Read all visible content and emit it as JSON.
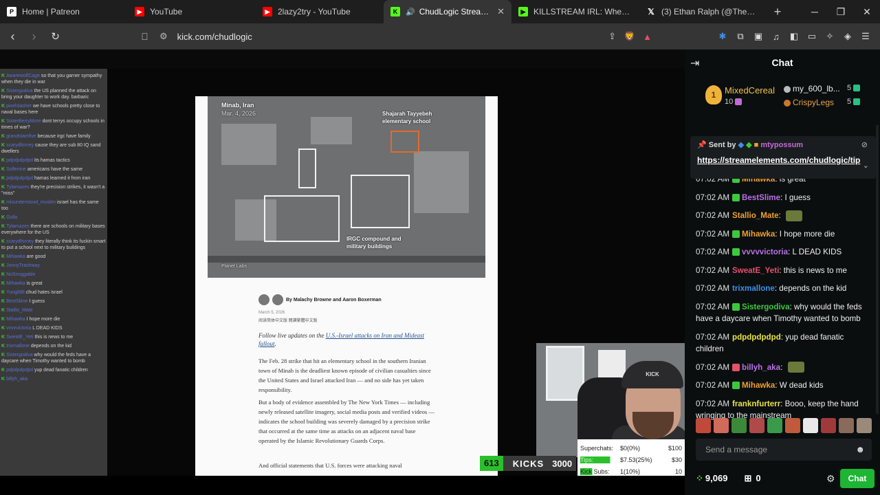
{
  "browser": {
    "tabs": [
      {
        "label": "Home | Patreon",
        "active": false
      },
      {
        "label": "YouTube",
        "active": false
      },
      {
        "label": "2lazy2try - YouTube",
        "active": false
      },
      {
        "label": "ChudLogic Stream - Wat",
        "active": true
      },
      {
        "label": "KILLSTREAM IRL: When Ethan M",
        "active": false
      },
      {
        "label": "(3) Ethan Ralph (@TheRalphRet",
        "active": false
      }
    ],
    "url": "kick.com/chudlogic"
  },
  "stream": {
    "overlay_chat": [
      {
        "user": "AwarewolfCage",
        "text": "so that you garner sympathy when they die in war"
      },
      {
        "user": "Sistergodiva",
        "text": "the US planned the attack on bring your daughter to work day. barbaric"
      },
      {
        "user": "pixelslasher",
        "text": "we have schools pretty close to naval bases here"
      },
      {
        "user": "SisterBerryMore",
        "text": "dont terrys occupy schools in times of war?"
      },
      {
        "user": "grandslamfive",
        "text": "because irgc have family"
      },
      {
        "user": "scarydforney",
        "text": "cause they are sub 80 IQ sand dwellers"
      },
      {
        "user": "pdpdpdpdpd",
        "text": "its hamas tactics"
      },
      {
        "user": "Sollenine",
        "text": "americans have the same"
      },
      {
        "user": "pdpdpdpdpd",
        "text": "hamas learned it from iran"
      },
      {
        "user": "Tylamazes",
        "text": "they're precision strikes, it wasn't a \"miss\""
      },
      {
        "user": "misunderstood_muslim",
        "text": "israel has the same too"
      },
      {
        "user": "Gollo",
        "text": ""
      },
      {
        "user": "Tylamazes",
        "text": "there are schools on military bases everywhere for the US"
      },
      {
        "user": "scarydforney",
        "text": "they literally think its fuckin smart to put a school next to military buildings"
      },
      {
        "user": "Mihawka",
        "text": "are good"
      },
      {
        "user": "JonnyTrashway",
        "text": ""
      },
      {
        "user": "NoSnoggable",
        "text": ""
      },
      {
        "user": "Mihawka",
        "text": "is great"
      },
      {
        "user": "Yungli88",
        "text": "chud hates israel"
      },
      {
        "user": "BestSlime",
        "text": "I guess"
      },
      {
        "user": "Stallio_Mate",
        "text": ""
      },
      {
        "user": "Mihawka",
        "text": "I hope more die"
      },
      {
        "user": "vvvvvictoria",
        "text": "L DEAD KIDS"
      },
      {
        "user": "SweatE_Yeti",
        "text": "this is news to me"
      },
      {
        "user": "trixmallone",
        "text": "depends on the kid"
      },
      {
        "user": "Sistergodiva",
        "text": "why would the feds have a daycare when Timothy wanted to bomb"
      },
      {
        "user": "pdpdpdpdpd",
        "text": "yup dead fanatic children"
      },
      {
        "user": "billyh_aka",
        "text": ""
      }
    ],
    "article": {
      "photo_location": "Minab, Iran",
      "photo_date": "Mar. 4, 2026",
      "label_school": "Shajarah Tayyebeh elementary school",
      "label_irgc": "IRGC compound and military buildings",
      "photo_credit": "Planet Labs",
      "byline": "By Malachy Browne and Aaron Boxerman",
      "date": "March 5, 2026",
      "lang_links": "阅读简体中文版  閱讀繁體中文版",
      "follow_prefix": "Follow live updates on the ",
      "follow_link": "U.S.-Israel attacks on Iran and Mideast fallout",
      "follow_suffix": ".",
      "p1": "The Feb. 28 strike that hit an elementary school in the southern Iranian town of Minab is the deadliest known episode of civilian casualties since the United States and Israel attacked Iran — and no side has yet taken responsibility.",
      "p2": "But a body of evidence assembled by The New York Times — including newly released satellite imagery, social media posts and verified videos — indicates the school building was severely damaged by a precision strike that occurred at the same time as attacks on an adjacent naval base operated by the Islamic Revolutionary Guards Corps.",
      "p3": "And official statements that U.S. forces were attacking naval"
    },
    "webcam_label": "KICK",
    "kicks_goal": {
      "current": "613",
      "label": "KICKS",
      "target": "3000"
    },
    "stats": [
      {
        "name": "Superchats:",
        "value": "$0(0%)",
        "target": "$100",
        "fill": 0.0
      },
      {
        "name": "Tips:",
        "value": "$7.53(25%)",
        "target": "$30",
        "fill": 0.25
      },
      {
        "name": "Kick Subs:",
        "value": "1(10%)",
        "target": "10",
        "fill": 0.1
      }
    ]
  },
  "chat": {
    "title": "Chat",
    "leaderboard": {
      "first": {
        "rank": "1",
        "name": "MixedCereal",
        "count": "10"
      },
      "second": {
        "name": "my_600_lb...",
        "count": "5"
      },
      "third": {
        "name": "CrispyLegs",
        "count": "5"
      }
    },
    "pinned": {
      "prefix": "Sent by",
      "user": "mtypossum",
      "link": "https://streamelements.com/chudlogic/tip"
    },
    "messages": [
      {
        "time": "07:02 AM",
        "user": "Mihawka",
        "color": "#f0a030",
        "text": "is great",
        "icon": "#3cc83c"
      },
      {
        "time": "07:02 AM",
        "user": "BestSlime",
        "color": "#b870e6",
        "text": "I guess",
        "icon": "#3cc83c"
      },
      {
        "time": "07:02 AM",
        "user": "Stallio_Mate",
        "color": "#f0a030",
        "text": "",
        "icon": ""
      },
      {
        "time": "07:02 AM",
        "user": "Mihawka",
        "color": "#f0a030",
        "text": "I hope more die",
        "icon": "#3cc83c"
      },
      {
        "time": "07:02 AM",
        "user": "vvvvvictoria",
        "color": "#b870e6",
        "text": "L DEAD KIDS",
        "icon": "#3cc83c"
      },
      {
        "time": "07:02 AM",
        "user": "SweatE_Yeti",
        "color": "#e5506a",
        "text": "this is news to me",
        "icon": ""
      },
      {
        "time": "07:02 AM",
        "user": "trixmallone",
        "color": "#3f8fe8",
        "text": "depends on the kid",
        "icon": ""
      },
      {
        "time": "07:02 AM",
        "user": "Sistergodiva",
        "color": "#3cc83c",
        "text": "why would the feds have a daycare when Timothy wanted to bomb",
        "icon": "#3cc83c"
      },
      {
        "time": "07:02 AM",
        "user": "pdpdpdpdpd",
        "color": "#e8e24a",
        "text": "yup dead fanatic children",
        "icon": ""
      },
      {
        "time": "07:02 AM",
        "user": "billyh_aka",
        "color": "#b870e6",
        "text": "",
        "icon": "#e5506a"
      },
      {
        "time": "07:02 AM",
        "user": "Mihawka",
        "color": "#f0a030",
        "text": "W dead kids",
        "icon": "#3cc83c"
      },
      {
        "time": "07:02 AM",
        "user": "franknfurterr",
        "color": "#e8e24a",
        "text": "Booo, keep the hand wringing to the mainstream",
        "icon": ""
      }
    ],
    "input_placeholder": "Send a message",
    "points": "9,069",
    "gifts": "0",
    "send_label": "Chat"
  },
  "colors": {
    "kick_green": "#53fc18",
    "chat_bg": "#0b0e0f"
  }
}
